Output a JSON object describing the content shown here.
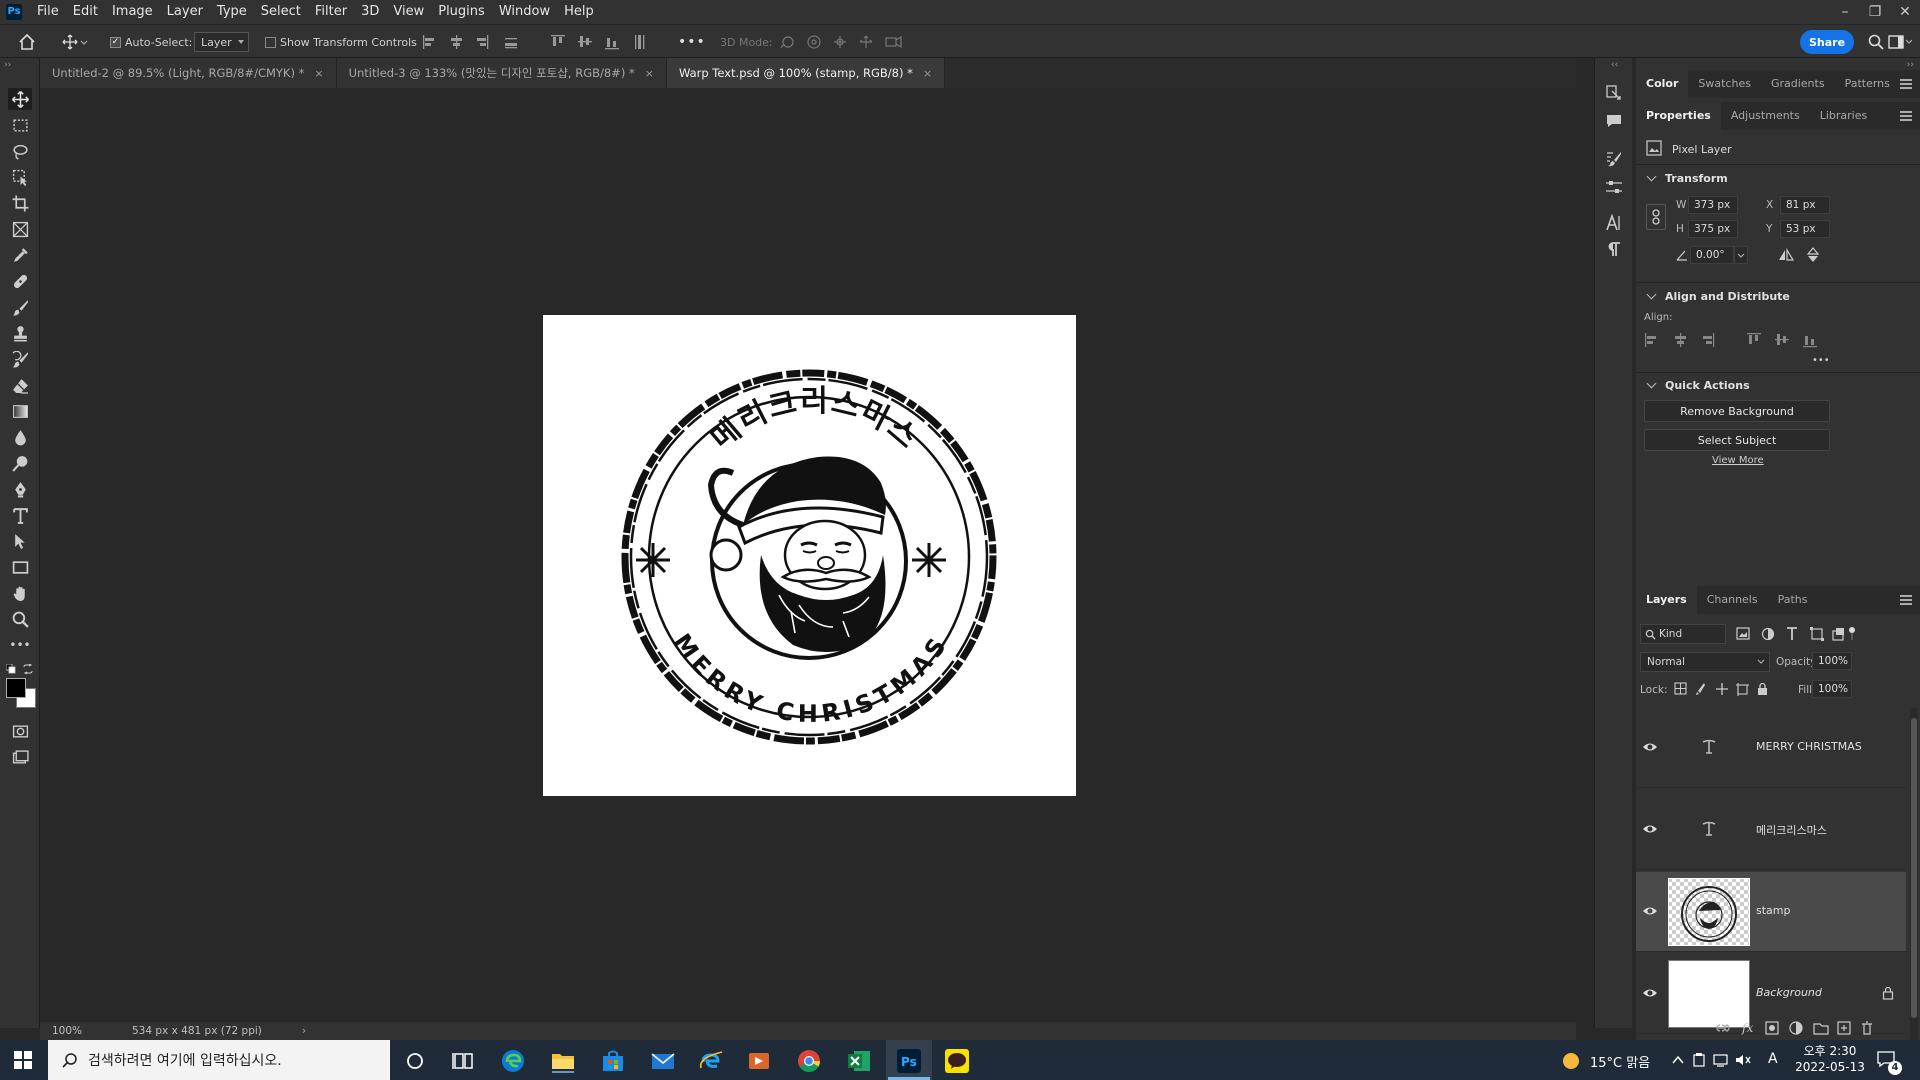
{
  "app": {
    "logo_text": "Ps"
  },
  "menu": [
    "File",
    "Edit",
    "Image",
    "Layer",
    "Type",
    "Select",
    "Filter",
    "3D",
    "View",
    "Plugins",
    "Window",
    "Help"
  ],
  "window_controls": {
    "minimize": "–",
    "restore": "❐",
    "close": "✕"
  },
  "options": {
    "auto_select_label": "Auto-Select:",
    "auto_select_value": "Layer",
    "show_transform_label": "Show Transform Controls",
    "three_d_mode_label": "3D Mode:",
    "more": "•••",
    "share_label": "Share"
  },
  "tabs": [
    {
      "label": "Untitled-2 @ 89.5% (Light, RGB/8#/CMYK) *",
      "close": "×"
    },
    {
      "label": "Untitled-3 @ 133% (맛있는 디자인 포토샵, RGB/8#) *",
      "close": "×"
    },
    {
      "label": "Warp Text.psd @ 100% (stamp, RGB/8) *",
      "close": "×"
    }
  ],
  "canvas": {
    "top_text": "메리크리스마스",
    "bottom_text": "MERRY CHRISTMAS"
  },
  "status": {
    "zoom": "100%",
    "doc_info": "534 px x 481 px (72 ppi)",
    "arrow": "›"
  },
  "color_panel": {
    "tabs": [
      "Color",
      "Swatches",
      "Gradients",
      "Patterns"
    ]
  },
  "properties_panel": {
    "tabs": [
      "Properties",
      "Adjustments",
      "Libraries"
    ],
    "layer_type": "Pixel Layer",
    "transform": {
      "title": "Transform",
      "w_label": "W",
      "w": "373 px",
      "h_label": "H",
      "h": "375 px",
      "x_label": "X",
      "x": "81 px",
      "y_label": "Y",
      "y": "53 px",
      "angle": "0.00°"
    },
    "align": {
      "title": "Align and Distribute",
      "label": "Align:",
      "more": "•••"
    },
    "quick_actions": {
      "title": "Quick Actions",
      "remove_bg": "Remove Background",
      "select_subject": "Select Subject",
      "view_more": "View More"
    }
  },
  "layers_panel": {
    "tabs": [
      "Layers",
      "Channels",
      "Paths"
    ],
    "filter_kind": "Kind",
    "blend_mode": "Normal",
    "opacity_label": "Opacity:",
    "opacity": "100%",
    "lock_label": "Lock:",
    "fill_label": "Fill:",
    "fill": "100%",
    "layers": [
      {
        "name": "MERRY CHRISTMAS",
        "type": "text"
      },
      {
        "name": "메리크리스마스",
        "type": "text"
      },
      {
        "name": "stamp",
        "type": "pixel",
        "selected": true
      },
      {
        "name": "Background",
        "type": "background",
        "locked": true
      }
    ]
  },
  "taskbar": {
    "search_placeholder": "검색하려면 여기에 입력하십시오.",
    "weather": "15°C 맑음",
    "ime": "A",
    "time": "오후 2:30",
    "date": "2022-05-13",
    "notifications": "4"
  },
  "colors": {
    "accent": "#1473e6",
    "panel_bg": "#323232",
    "canvas_bg": "#282828",
    "taskbar_bg": "#1f2b38"
  }
}
